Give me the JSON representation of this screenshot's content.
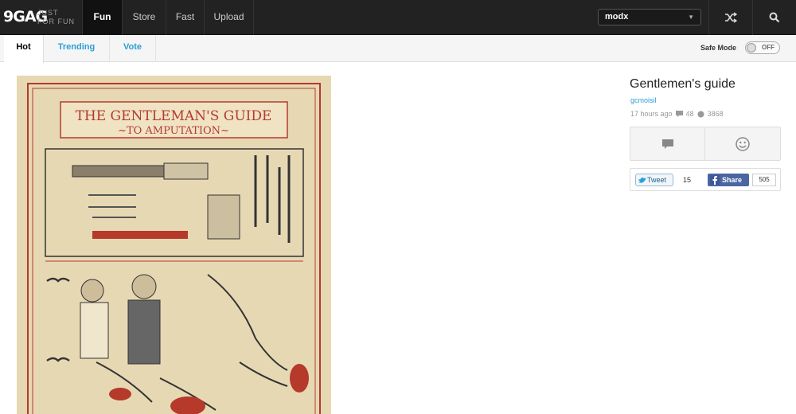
{
  "topbar": {
    "logo": "9GAG",
    "tagline_1": "JUST",
    "tagline_2": "FOR FUN",
    "nav": [
      "Fun",
      "Store",
      "Fast",
      "Upload"
    ],
    "section_select": {
      "value": "modx"
    }
  },
  "subbar": {
    "tabs": [
      "Hot",
      "Trending",
      "Vote"
    ],
    "safe_mode_label": "Safe Mode",
    "safe_mode_state": "OFF"
  },
  "post": {
    "title": "Gentlemen's guide",
    "author": "gcmoisil",
    "time": "17 hours ago",
    "comments": "48",
    "points": "3868",
    "image": {
      "heading_1": "THE GENTLEMAN'S GUIDE",
      "heading_2": "~TO AMPUTATION~"
    }
  },
  "share": {
    "tweet_label": "Tweet",
    "tweet_count": "15",
    "fb_label": "Share",
    "fb_count": "505"
  },
  "colors": {
    "topbar_bg": "#222222",
    "link_blue": "#2a9fd6",
    "facebook_blue": "#4a66a0",
    "parchment": "#e7d8b4",
    "poster_red": "#b53a2c"
  },
  "icons": [
    "shuffle-icon",
    "search-icon",
    "comment-icon",
    "smile-icon",
    "twitter-icon",
    "facebook-icon",
    "mustache-icon"
  ]
}
